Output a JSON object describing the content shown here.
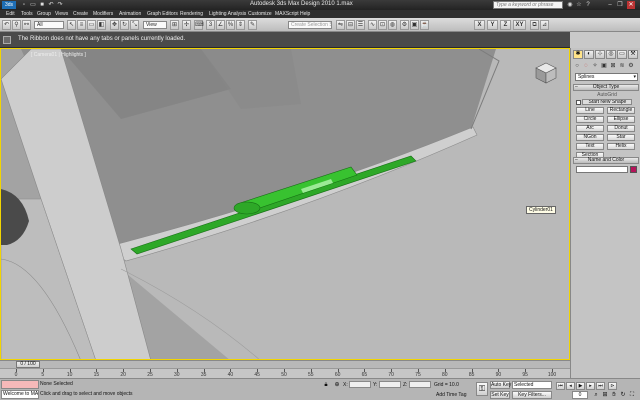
{
  "titlebar": {
    "logo": "3ds",
    "title": "Autodesk 3ds Max Design 2010      1.max",
    "search_placeholder": "Type a keyword or phrase",
    "help_icons": [
      "binoculars-icon",
      "star-icon",
      "help-icon"
    ],
    "window_icons": [
      "minimize-icon",
      "restore-icon",
      "close-icon"
    ]
  },
  "menu": {
    "items": [
      "Edit",
      "Tools",
      "Group",
      "Views",
      "Create",
      "Modifiers",
      "Animation",
      "Graph Editors",
      "Rendering",
      "Lighting Analysis",
      "Customize",
      "MAXScript",
      "Help"
    ]
  },
  "toolbar": {
    "filter_value": "All",
    "view_value": "View",
    "selection_set_placeholder": "Create Selection Se",
    "axis_labels": [
      "X",
      "Y",
      "Z",
      "XY"
    ]
  },
  "ribbon": {
    "message": "The Ribbon does not have any tabs or panels currently loaded."
  },
  "viewport": {
    "label": "[ Camera01 | Highlights ]",
    "tooltip": "Cylinder01",
    "accent_color": "#2ea828",
    "border_color": "#f2d500"
  },
  "command_panel": {
    "category_value": "Splines",
    "object_type_title": "Object Type",
    "autogrid_label": "AutoGrid",
    "start_new_shape_label": "Start New Shape",
    "buttons": [
      "Line",
      "Rectangle",
      "Circle",
      "Ellipse",
      "Arc",
      "Donut",
      "NGon",
      "Star",
      "Text",
      "Helix",
      "Section"
    ],
    "name_color_title": "Name and Color",
    "swatch_color": "#b4145a"
  },
  "timeline": {
    "frame_display": "0 / 100",
    "ticks": [
      "0",
      "5",
      "10",
      "15",
      "20",
      "25",
      "30",
      "35",
      "40",
      "45",
      "50",
      "55",
      "60",
      "65",
      "70",
      "75",
      "80",
      "85",
      "90",
      "95",
      "100"
    ]
  },
  "status": {
    "welcome": "Welcome to MAX",
    "selection": "None Selected",
    "prompt": "Click and drag to select and move objects",
    "x_label": "X:",
    "y_label": "Y:",
    "z_label": "Z:",
    "grid": "Grid = 10.0",
    "add_time_tag": "Add Time Tag",
    "auto_key": "Auto Key",
    "set_key": "Set Key",
    "selected_value": "Selected",
    "key_filters": "Key Filters...",
    "current_frame": "0"
  }
}
